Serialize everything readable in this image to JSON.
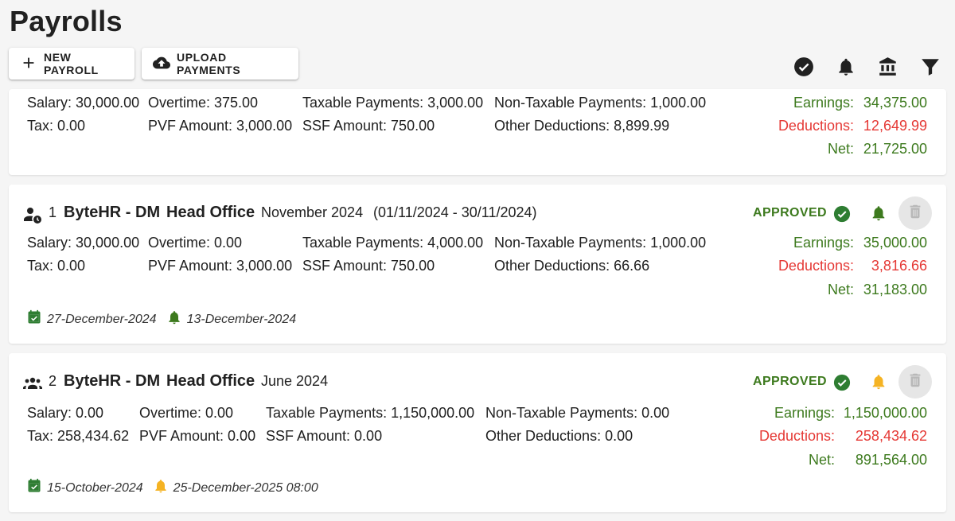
{
  "page_title": "Payrolls",
  "toolbar": {
    "new_payroll_label": "NEW PAYROLL",
    "upload_payments_label": "UPLOAD PAYMENTS",
    "icons": [
      "check-circle-icon",
      "bell-icon",
      "bank-icon",
      "filter-icon"
    ]
  },
  "colors": {
    "green": "#3d7a1e",
    "red": "#e53935",
    "amber": "#f5b323",
    "card": "#ffffff",
    "background": "#f5f5f5"
  },
  "payrolls": [
    {
      "fields": {
        "salary": "Salary: 30,000.00",
        "overtime": "Overtime: 375.00",
        "taxable": "Taxable Payments: 3,000.00",
        "non_taxable": "Non-Taxable Payments: 1,000.00",
        "tax": "Tax: 0.00",
        "pvf": "PVF Amount: 3,000.00",
        "ssf": "SSF Amount: 750.00",
        "other": "Other Deductions: 8,899.99"
      },
      "totals": {
        "earnings_label": "Earnings:",
        "earnings": "34,375.00",
        "deductions_label": "Deductions:",
        "deductions": "12,649.99",
        "net_label": "Net:",
        "net": "21,725.00"
      }
    },
    {
      "number": "1",
      "company": "ByteHR - DM",
      "office": "Head Office",
      "period": "November 2024",
      "range": "(01/11/2024 - 30/11/2024)",
      "status": "APPROVED",
      "fields": {
        "salary": "Salary: 30,000.00",
        "overtime": "Overtime: 0.00",
        "taxable": "Taxable Payments: 4,000.00",
        "non_taxable": "Non-Taxable Payments: 1,000.00",
        "tax": "Tax: 0.00",
        "pvf": "PVF Amount: 3,000.00",
        "ssf": "SSF Amount: 750.00",
        "other": "Other Deductions: 66.66"
      },
      "totals": {
        "earnings_label": "Earnings:",
        "earnings": "35,000.00",
        "deductions_label": "Deductions:",
        "deductions": "3,816.66",
        "net_label": "Net:",
        "net": "31,183.00"
      },
      "payment_date": "27-December-2024",
      "notify_date": "13-December-2024"
    },
    {
      "number": "2",
      "company": "ByteHR - DM",
      "office": "Head Office",
      "period": "June 2024",
      "status": "APPROVED",
      "fields": {
        "salary": "Salary: 0.00",
        "overtime": "Overtime: 0.00",
        "taxable": "Taxable Payments: 1,150,000.00",
        "non_taxable": "Non-Taxable Payments: 0.00",
        "tax": "Tax: 258,434.62",
        "pvf": "PVF Amount: 0.00",
        "ssf": "SSF Amount: 0.00",
        "other": "Other Deductions: 0.00"
      },
      "totals": {
        "earnings_label": "Earnings:",
        "earnings": "1,150,000.00",
        "deductions_label": "Deductions:",
        "deductions": "258,434.62",
        "net_label": "Net:",
        "net": "891,564.00"
      },
      "payment_date": "15-October-2024",
      "notify_date": "25-December-2025 08:00"
    }
  ]
}
